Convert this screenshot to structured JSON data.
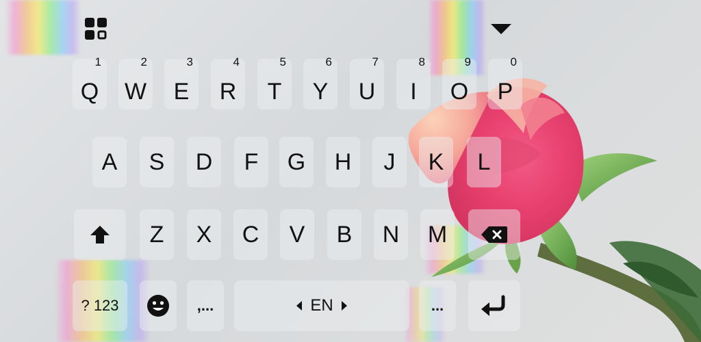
{
  "keyboard": {
    "row1": [
      {
        "key": "Q",
        "hint": "1"
      },
      {
        "key": "W",
        "hint": "2"
      },
      {
        "key": "E",
        "hint": "3"
      },
      {
        "key": "R",
        "hint": "4"
      },
      {
        "key": "T",
        "hint": "5"
      },
      {
        "key": "Y",
        "hint": "6"
      },
      {
        "key": "U",
        "hint": "7"
      },
      {
        "key": "I",
        "hint": "8"
      },
      {
        "key": "O",
        "hint": "9"
      },
      {
        "key": "P",
        "hint": "0"
      }
    ],
    "row2": [
      "A",
      "S",
      "D",
      "F",
      "G",
      "H",
      "J",
      "K",
      "L"
    ],
    "row3": [
      "Z",
      "X",
      "C",
      "V",
      "B",
      "N",
      "M"
    ],
    "symbols_label": "? 123",
    "comma_label": ",...",
    "language_label": "EN",
    "period_label": "...",
    "icons": {
      "menu": "grid-icon",
      "collapse": "triangle-down-icon",
      "shift": "shift-icon",
      "backspace": "backspace-icon",
      "emoji": "emoji-icon",
      "lang_left": "arrow-left-icon",
      "lang_right": "arrow-right-icon",
      "enter": "enter-icon"
    }
  }
}
